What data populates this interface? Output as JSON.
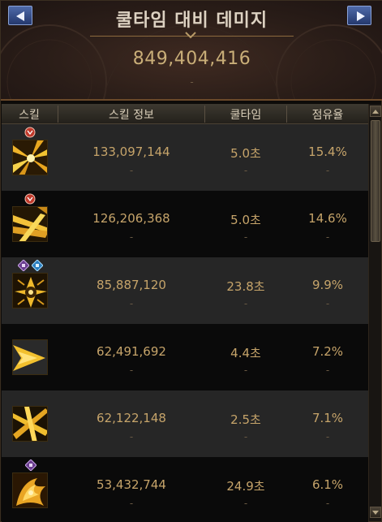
{
  "header": {
    "title": "쿨타임 대비 데미지",
    "total_value": "849,404,416",
    "total_sub": "-"
  },
  "columns": [
    "스킬",
    "스킬 정보",
    "쿨타임",
    "점유율"
  ],
  "rows": [
    {
      "damage": "133,097,144",
      "damage_sub": "-",
      "cooldown": "5.0초",
      "cooldown_sub": "-",
      "share": "15.4%",
      "share_sub": "-",
      "icon": "gold-radiant-burst-icon",
      "badges": [
        "red-rune-badge"
      ]
    },
    {
      "damage": "126,206,368",
      "damage_sub": "-",
      "cooldown": "5.0초",
      "cooldown_sub": "-",
      "share": "14.6%",
      "share_sub": "-",
      "icon": "gold-slash-strike-icon",
      "badges": [
        "red-rune-badge"
      ]
    },
    {
      "damage": "85,887,120",
      "damage_sub": "-",
      "cooldown": "23.8초",
      "cooldown_sub": "-",
      "share": "9.9%",
      "share_sub": "-",
      "icon": "gold-claw-burst-icon",
      "badges": [
        "purple-diamond-badge",
        "blue-diamond-badge"
      ]
    },
    {
      "damage": "62,491,692",
      "damage_sub": "-",
      "cooldown": "4.4초",
      "cooldown_sub": "-",
      "share": "7.2%",
      "share_sub": "-",
      "icon": "gold-arrow-thrust-icon",
      "badges": []
    },
    {
      "damage": "62,122,148",
      "damage_sub": "-",
      "cooldown": "2.5초",
      "cooldown_sub": "-",
      "share": "7.1%",
      "share_sub": "-",
      "icon": "gold-crossed-blades-icon",
      "badges": []
    },
    {
      "damage": "53,432,744",
      "damage_sub": "-",
      "cooldown": "24.9초",
      "cooldown_sub": "-",
      "share": "6.1%",
      "share_sub": "-",
      "icon": "gold-fire-swirl-icon",
      "badges": [
        "purple-diamond-badge"
      ]
    }
  ],
  "colors": {
    "value_text": "#c6a46a",
    "header_bg": "#2a1d18",
    "nav_button": "#3a5293",
    "row_odd": "#262626",
    "row_even": "#0a0a0a"
  }
}
